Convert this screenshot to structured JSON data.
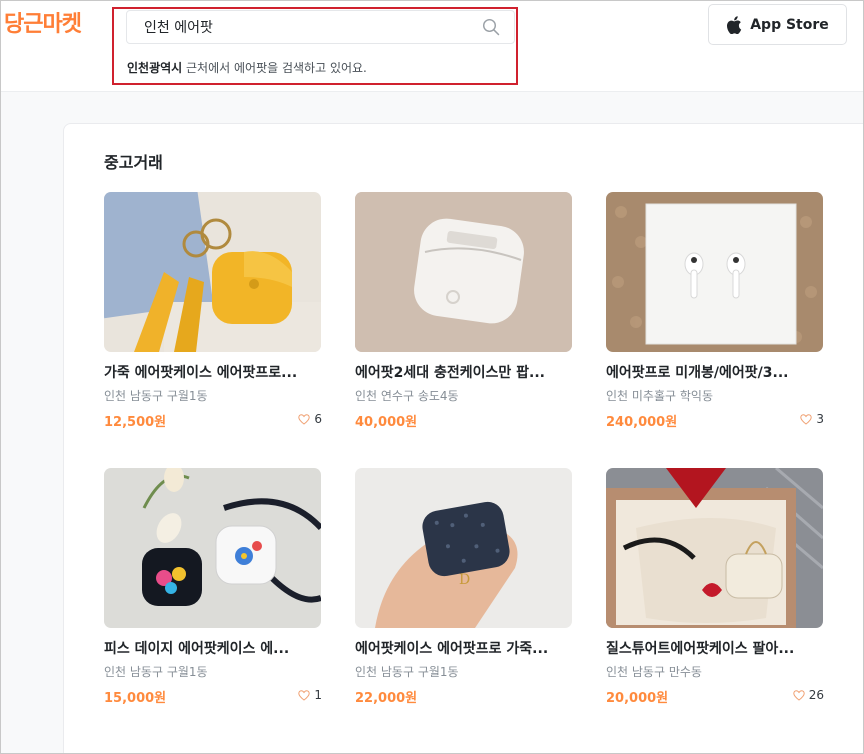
{
  "header": {
    "logo": "당근마켓",
    "search": {
      "value": "인천 에어팟",
      "placeholder": ""
    },
    "hint": {
      "region": "인천광역시",
      "text": " 근처에서 에어팟을 검색하고 있어요."
    },
    "app_store_label": "App Store"
  },
  "section": {
    "title": "중고거래"
  },
  "items": [
    {
      "title": "가죽 에어팟케이스 에어팟프로...",
      "location": "인천 남동구 구월1동",
      "price": "12,500원",
      "likes": "6"
    },
    {
      "title": "에어팟2세대 충전케이스만 팝...",
      "location": "인천 연수구 송도4동",
      "price": "40,000원",
      "likes": ""
    },
    {
      "title": "에어팟프로 미개봉/에어팟/3...",
      "location": "인천 미추홀구 학익동",
      "price": "240,000원",
      "likes": "3"
    },
    {
      "title": "피스 데이지 에어팟케이스 에...",
      "location": "인천 남동구 구월1동",
      "price": "15,000원",
      "likes": "1"
    },
    {
      "title": "에어팟케이스 에어팟프로 가죽...",
      "location": "인천 남동구 구월1동",
      "price": "22,000원",
      "likes": ""
    },
    {
      "title": "질스튜어트에어팟케이스 팔아...",
      "location": "인천 남동구 만수동",
      "price": "20,000원",
      "likes": "26"
    }
  ],
  "colors": {
    "brand": "#ff7e36",
    "price": "#ff8a3d",
    "highlight": "#d0212e"
  }
}
